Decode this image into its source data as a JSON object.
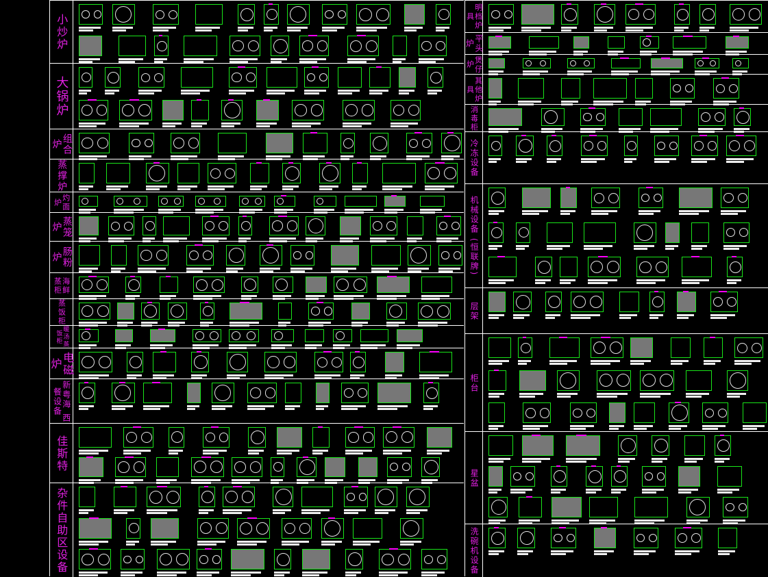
{
  "left_sections": [
    {
      "label": "小炒炉"
    },
    {
      "label": "大锅炉"
    },
    {
      "label": "组合炉"
    },
    {
      "label": "蒸撑炉"
    },
    {
      "label": "灼面炉"
    },
    {
      "label": "蒸笼炉"
    },
    {
      "label": "肠粉炉"
    },
    {
      "label": "海鲜蒸柜"
    },
    {
      "label": "蒸饭柜"
    },
    {
      "label": "暖汤蒸饭柜"
    },
    {
      "label": "电磁炉"
    },
    {
      "label": "新粤海 西餐设备"
    },
    {
      "label": "佳斯特"
    },
    {
      "label": "杂件自助区设备"
    }
  ],
  "right_sections": [
    {
      "label": "明档炉具"
    },
    {
      "label": "平头炉"
    },
    {
      "label": "煲仔炉"
    },
    {
      "label": "其他炉具"
    },
    {
      "label": "消毒柜"
    },
    {
      "label": "冷冻设备"
    },
    {
      "label": "机械设备 (恒联牌)"
    },
    {
      "label": "层架"
    },
    {
      "label": "柜台"
    },
    {
      "label": "星盆"
    },
    {
      "label": "洗碗机设备"
    }
  ],
  "colors": {
    "background": "#000000",
    "outline": "#19e619",
    "label": "#e020e0",
    "divider": "#ffffff",
    "accent": "#ff00ff"
  }
}
